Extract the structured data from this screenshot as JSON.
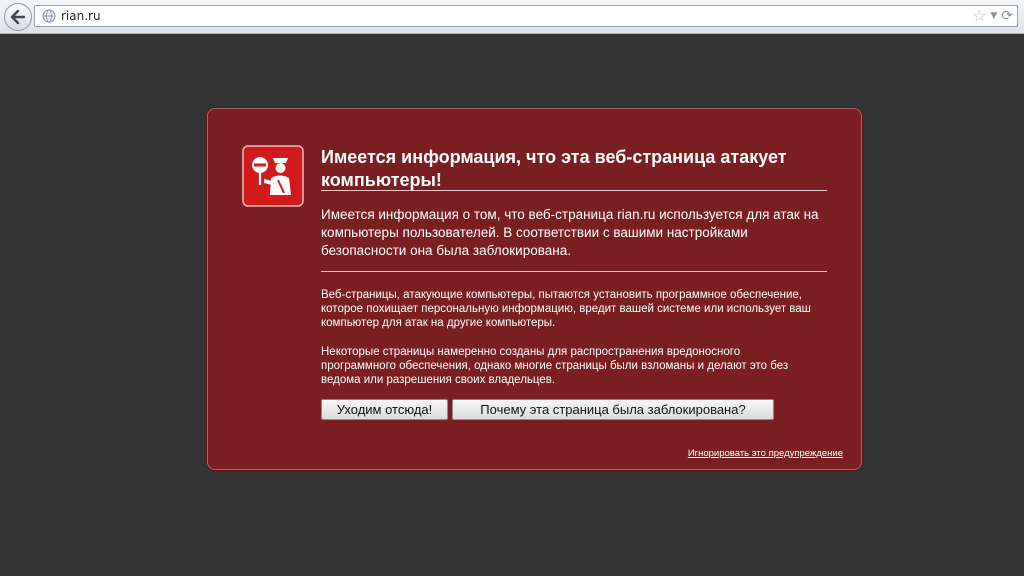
{
  "browser": {
    "url": "rian.ru",
    "icons": {
      "back": "back-arrow-icon",
      "site": "globe-icon",
      "bookmark": "star-icon",
      "history": "dropdown-icon",
      "reload": "reload-icon"
    }
  },
  "warning": {
    "title": "Имеется информация, что эта веб-страница атакует компьютеры!",
    "intro": "Имеется информация о том, что веб-страница rian.ru используется для атак на компьютеры пользователей. В соответствии с вашими настройками безопасности она была заблокирована.",
    "detail_1": "Веб-страницы, атакующие компьютеры, пытаются установить программное обеспечение, которое похищает персональную информацию, вредит вашей системе или использует ваш компьютер для атак на другие компьютеры.",
    "detail_2": "Некоторые страницы намеренно созданы для распространения вредоносного программного обеспечения, однако многие страницы были взломаны и делают это без ведома или разрешения своих владельцев.",
    "button_leave": "Уходим отсюда!",
    "button_why": "Почему эта страница была заблокирована?",
    "ignore_link": "Игнорировать это предупреждение",
    "icon": "police-warning-icon"
  },
  "colors": {
    "page_background": "#333333",
    "warning_background": "#7a1f21",
    "icon_red": "#d11a1a",
    "text": "#ffffff"
  }
}
